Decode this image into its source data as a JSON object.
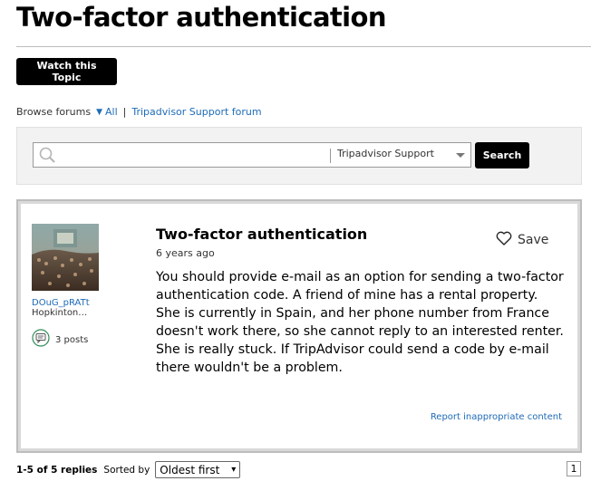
{
  "page": {
    "title": "Two-factor authentication",
    "watch_label": "Watch this Topic"
  },
  "breadcrumb": {
    "label": "Browse forums",
    "all": "All",
    "separator": "|",
    "forum": "Tripadvisor Support forum"
  },
  "search": {
    "placeholder": "",
    "scope": "Tripadvisor Support",
    "button_label": "Search"
  },
  "post": {
    "author": {
      "username": "DOuG_pRATt",
      "location": "Hopkinton…",
      "posts": "3 posts"
    },
    "title": "Two-factor authentication",
    "age": "6 years ago",
    "body": "You should provide e-mail as an option for sending a two-factor authentication code. A friend of mine has a rental property. She is currently in Spain, and her phone number from France doesn't work there, so she cannot reply to an interested renter. She is really stuck. If TripAdvisor could send a code by e-mail there wouldn't be a problem.",
    "save_label": "Save",
    "report_label": "Report inappropriate content"
  },
  "footer": {
    "replies_count": "1-5 of 5 replies",
    "sorted_label": "Sorted by",
    "sort_value": "Oldest first",
    "page": "1"
  },
  "colors": {
    "link": "#1e6bb8",
    "button_bg": "#000000"
  }
}
